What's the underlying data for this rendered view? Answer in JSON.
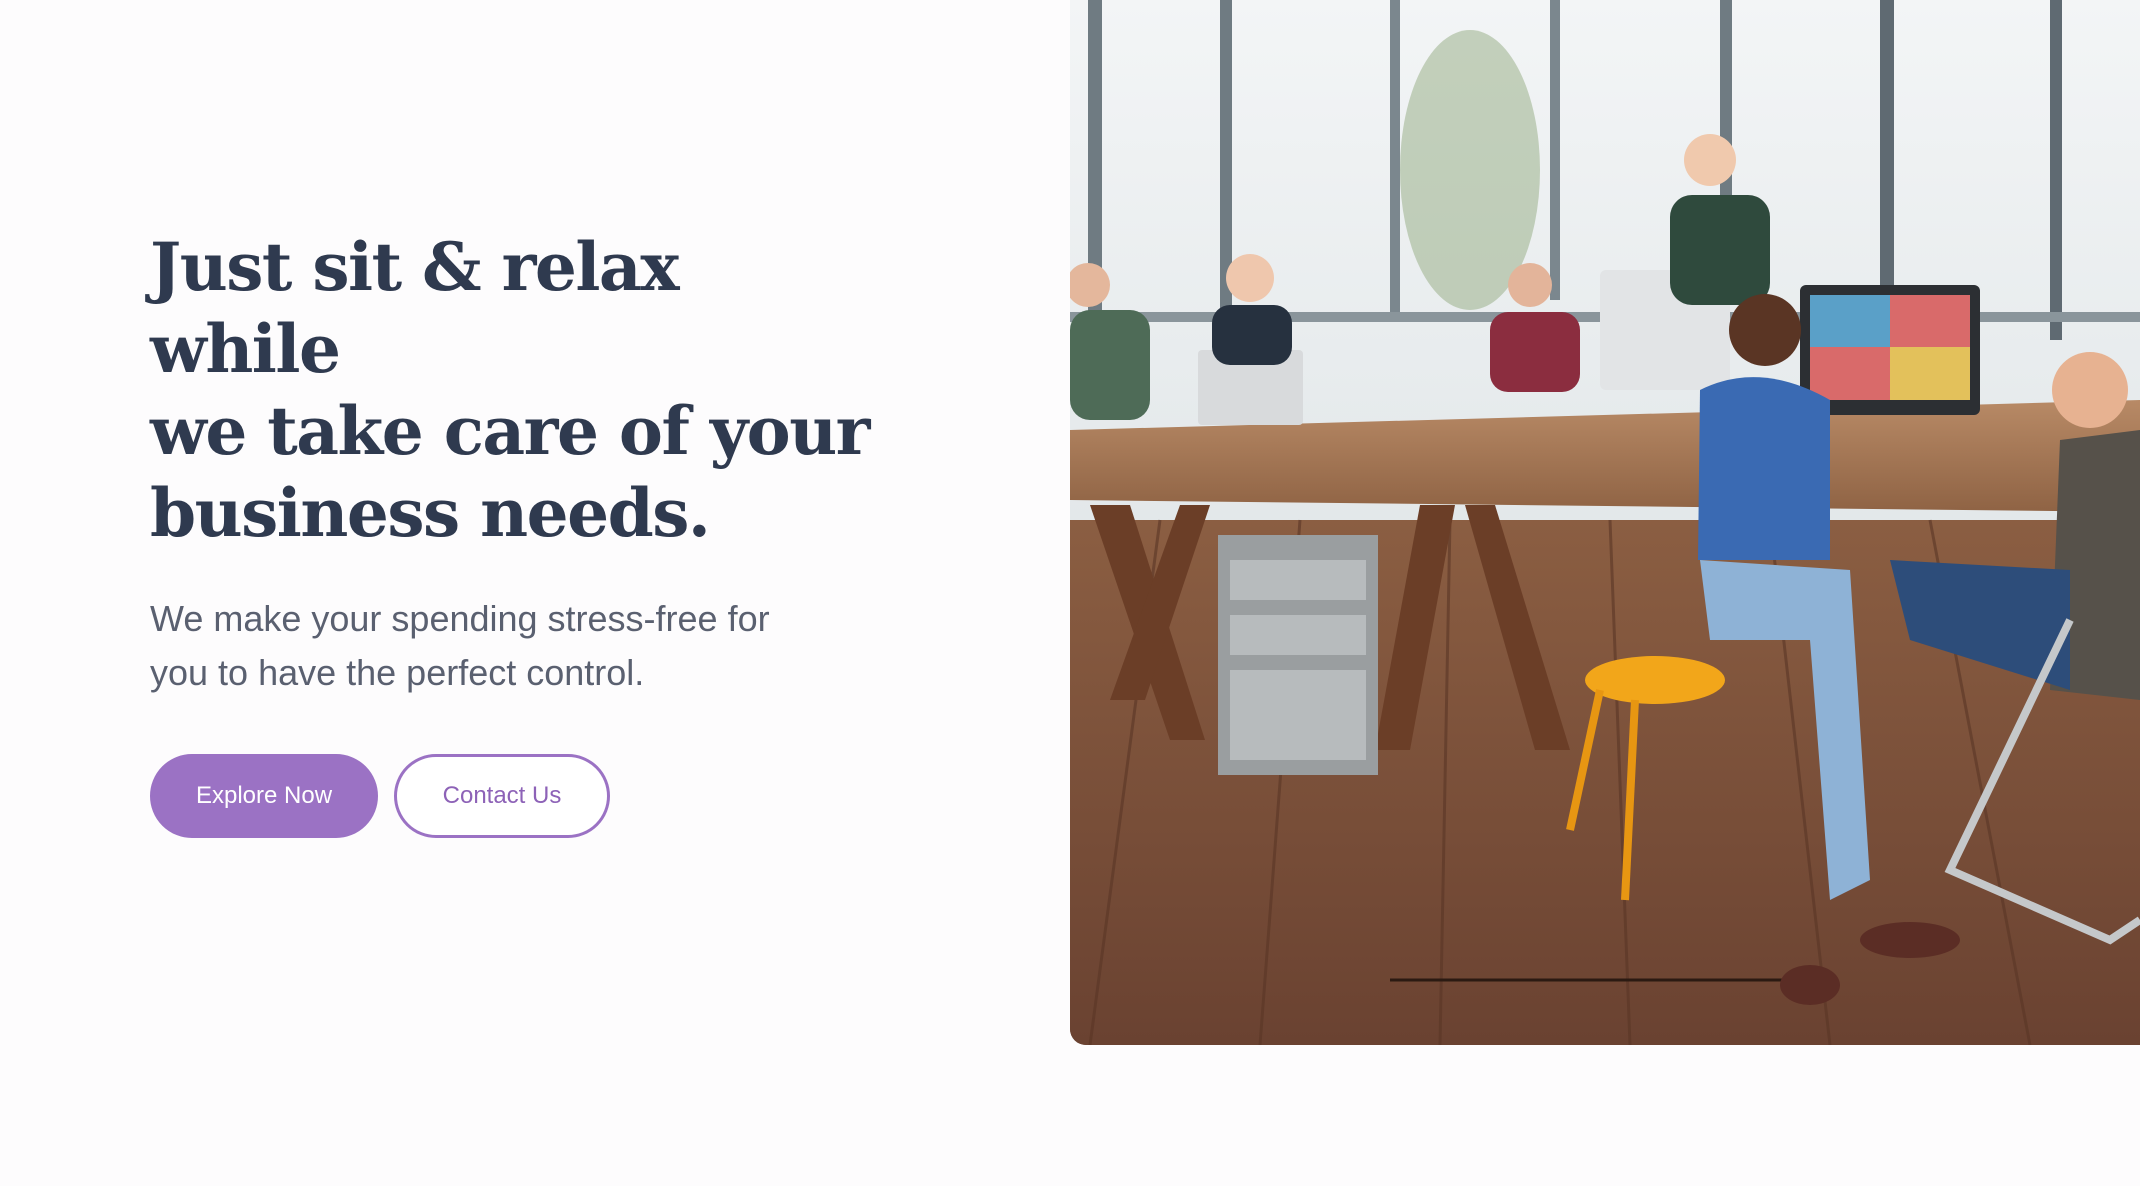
{
  "hero": {
    "headline_line1": "Just sit & relax while",
    "headline_line2": "we take care of your",
    "headline_line3": "business needs.",
    "subtext_line1": "We make your spending stress-free for",
    "subtext_line2": "you to have the perfect control.",
    "primary_button": "Explore Now",
    "secondary_button": "Contact Us"
  },
  "colors": {
    "headline": "#2f3a4f",
    "body_text": "#5a6070",
    "accent": "#9b72c4",
    "background": "#fdfcfd"
  }
}
